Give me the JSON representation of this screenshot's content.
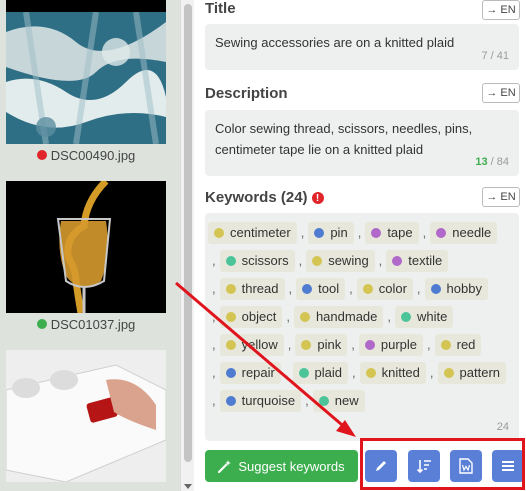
{
  "thumbnails": [
    {
      "filename": "",
      "status_color": "#e0262a"
    },
    {
      "filename": "DSC00490.jpg",
      "status_color": "#e0262a"
    },
    {
      "filename": "DSC01037.jpg",
      "status_color": "#3cae4e"
    }
  ],
  "title_section": {
    "label": "Title",
    "translate_label": "→ EN",
    "value": "Sewing accessories are on a knitted plaid",
    "counter": "7 / 41"
  },
  "description_section": {
    "label": "Description",
    "translate_label": "→ EN",
    "value": "Color sewing thread, scissors, needles, pins, centimeter tape lie on a knitted plaid",
    "counter_count": "13",
    "counter_total": " / 84"
  },
  "keywords_section": {
    "label": "Keywords (24)",
    "warning_icon": "!",
    "translate_label": "→ EN",
    "counter": "24",
    "items": [
      {
        "label": "centimeter",
        "color": "#d4c452"
      },
      {
        "label": "pin",
        "color": "#4f7bd1"
      },
      {
        "label": "tape",
        "color": "#b068c9"
      },
      {
        "label": "needle",
        "color": "#b068c9"
      },
      {
        "label": "scissors",
        "color": "#4cc49a"
      },
      {
        "label": "sewing",
        "color": "#d4c452"
      },
      {
        "label": "textile",
        "color": "#b068c9"
      },
      {
        "label": "thread",
        "color": "#d4c452"
      },
      {
        "label": "tool",
        "color": "#4f7bd1"
      },
      {
        "label": "color",
        "color": "#d4c452"
      },
      {
        "label": "hobby",
        "color": "#4f7bd1"
      },
      {
        "label": "object",
        "color": "#d4c452"
      },
      {
        "label": "handmade",
        "color": "#d4c452"
      },
      {
        "label": "white",
        "color": "#4cc49a"
      },
      {
        "label": "yellow",
        "color": "#d4c452"
      },
      {
        "label": "pink",
        "color": "#d4c452"
      },
      {
        "label": "purple",
        "color": "#b068c9"
      },
      {
        "label": "red",
        "color": "#d4c452"
      },
      {
        "label": "repair",
        "color": "#4f7bd1"
      },
      {
        "label": "plaid",
        "color": "#4cc49a"
      },
      {
        "label": "knitted",
        "color": "#d4c452"
      },
      {
        "label": "pattern",
        "color": "#d4c452"
      },
      {
        "label": "turquoise",
        "color": "#4f7bd1"
      },
      {
        "label": "new",
        "color": "#4cc49a"
      }
    ]
  },
  "actions": {
    "suggest_label": "Suggest keywords",
    "suggest_icon": "magic-wand-icon",
    "tools": [
      "pencil-icon",
      "sort-icon",
      "word-document-icon",
      "menu-icon"
    ]
  },
  "colors": {
    "accent_green": "#3cae4e",
    "accent_blue": "#5a7fd6",
    "highlight_red": "#e0141c"
  }
}
